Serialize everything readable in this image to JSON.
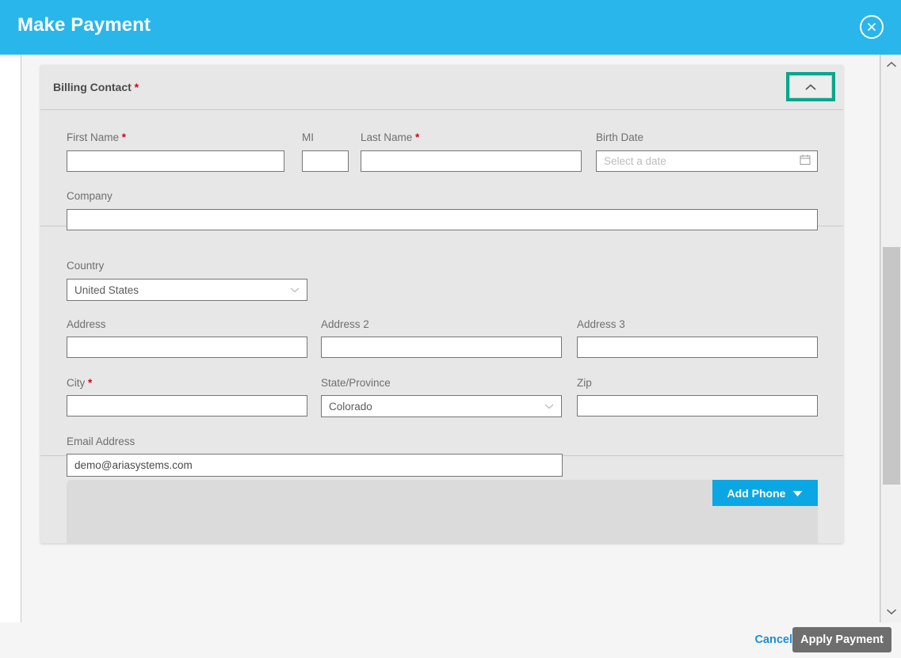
{
  "modal": {
    "title": "Make Payment",
    "close_icon": "close-circle-icon"
  },
  "panel": {
    "title": "Billing Contact",
    "required_marker": "*",
    "collapse_icon": "chevron-up-icon",
    "highlight_color": "#0aa68c"
  },
  "contact_section": {
    "first_name": {
      "label": "First Name",
      "required": "*",
      "value": "",
      "placeholder": ""
    },
    "mi": {
      "label": "MI",
      "value": "",
      "placeholder": ""
    },
    "last_name": {
      "label": "Last Name",
      "required": "*",
      "value": "",
      "placeholder": ""
    },
    "birth_date": {
      "label": "Birth Date",
      "value": "",
      "placeholder": "Select a date",
      "icon": "calendar-icon"
    },
    "company": {
      "label": "Company",
      "value": "",
      "placeholder": ""
    }
  },
  "address_section": {
    "country": {
      "label": "Country",
      "value": "United States",
      "icon": "chevron-down-icon"
    },
    "address": {
      "label": "Address",
      "value": "",
      "placeholder": ""
    },
    "address2": {
      "label": "Address 2",
      "value": "",
      "placeholder": ""
    },
    "address3": {
      "label": "Address 3",
      "value": "",
      "placeholder": ""
    },
    "city": {
      "label": "City",
      "required": "*",
      "value": "",
      "placeholder": ""
    },
    "state": {
      "label": "State/Province",
      "value": "Colorado",
      "icon": "chevron-down-icon"
    },
    "zip": {
      "label": "Zip",
      "value": "",
      "placeholder": ""
    },
    "email": {
      "label": "Email Address",
      "value": "demo@ariasystems.com",
      "placeholder": ""
    }
  },
  "phone_section": {
    "add_phone_label": "Add Phone",
    "add_phone_caret": "caret-down-icon"
  },
  "scrollbar": {
    "up_icon": "chevron-up-icon",
    "down_icon": "chevron-down-icon"
  },
  "footer": {
    "cancel_label": "Cancel",
    "apply_label": "Apply Payment"
  },
  "colors": {
    "header_blue": "#29b6ea",
    "accent_blue": "#0aa7e4",
    "link_blue": "#1c8fd6",
    "required_red": "#d0021b",
    "highlight_teal": "#0aa68c",
    "disabled_gray": "#6e6e6e"
  }
}
